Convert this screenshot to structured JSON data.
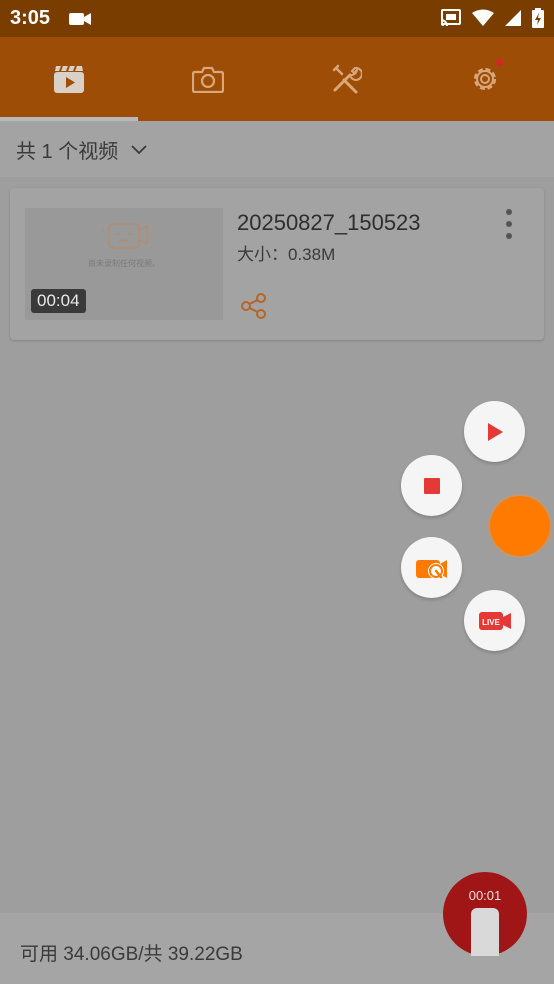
{
  "status_bar": {
    "time": "3:05"
  },
  "tabs": [
    {
      "icon": "video-library-icon",
      "selected": true
    },
    {
      "icon": "camera-icon",
      "selected": false
    },
    {
      "icon": "tools-icon",
      "selected": false
    },
    {
      "icon": "settings-icon",
      "selected": false,
      "badge": true
    }
  ],
  "header": {
    "count_label": "共 1 个视频"
  },
  "videos": [
    {
      "title": "20250827_150523",
      "size": "大小：0.38M",
      "duration": "00:04",
      "thumb_caption": "尚未录制任何视频。"
    }
  ],
  "floating_menu": {
    "items": [
      "play-icon",
      "stop-icon",
      "camera-tools-icon",
      "live-icon"
    ],
    "live_label": "LIVE"
  },
  "storage": {
    "text": "可用 34.06GB/共 39.22GB"
  },
  "recording": {
    "elapsed": "00:01"
  },
  "colors": {
    "accent": "#ff7a00",
    "toolbar": "#9d4d06",
    "status_bar": "#7a3d00",
    "record_red": "#e53935"
  }
}
